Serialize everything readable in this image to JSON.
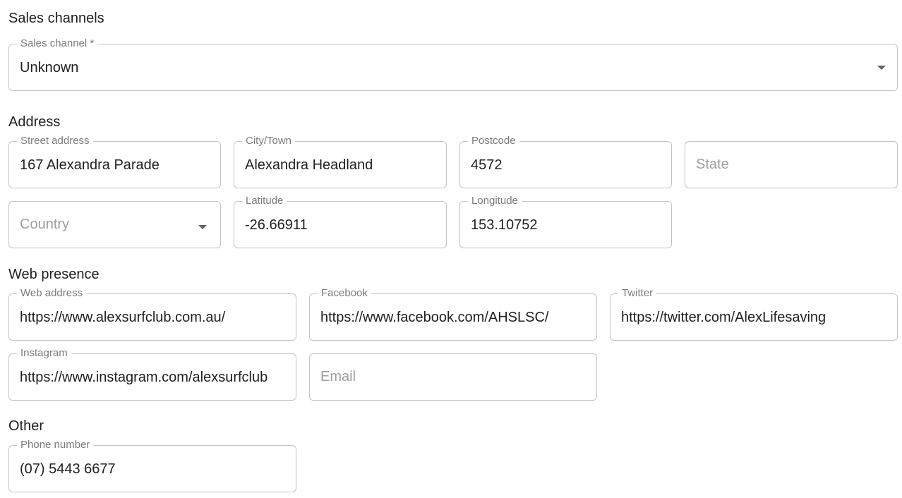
{
  "sections": {
    "sales": "Sales channels",
    "address": "Address",
    "web": "Web presence",
    "other": "Other"
  },
  "sales_channel": {
    "label": "Sales channel *",
    "value": "Unknown"
  },
  "address": {
    "street": {
      "label": "Street address",
      "value": "167 Alexandra Parade"
    },
    "city": {
      "label": "City/Town",
      "value": "Alexandra Headland"
    },
    "postcode": {
      "label": "Postcode",
      "value": "4572"
    },
    "state": {
      "placeholder": "State"
    },
    "country": {
      "placeholder": "Country"
    },
    "latitude": {
      "label": "Latitude",
      "value": "-26.66911"
    },
    "longitude": {
      "label": "Longitude",
      "value": "153.10752"
    }
  },
  "web": {
    "web_address": {
      "label": "Web address",
      "value": "https://www.alexsurfclub.com.au/"
    },
    "facebook": {
      "label": "Facebook",
      "value": "https://www.facebook.com/AHSLSC/"
    },
    "twitter": {
      "label": "Twitter",
      "value": "https://twitter.com/AlexLifesaving"
    },
    "instagram": {
      "label": "Instagram",
      "value": "https://www.instagram.com/alexsurfclub"
    },
    "email": {
      "placeholder": "Email"
    }
  },
  "other": {
    "phone": {
      "label": "Phone number",
      "value": "(07) 5443 6677"
    }
  },
  "icons": {
    "dropdown": "caret-down-icon"
  }
}
